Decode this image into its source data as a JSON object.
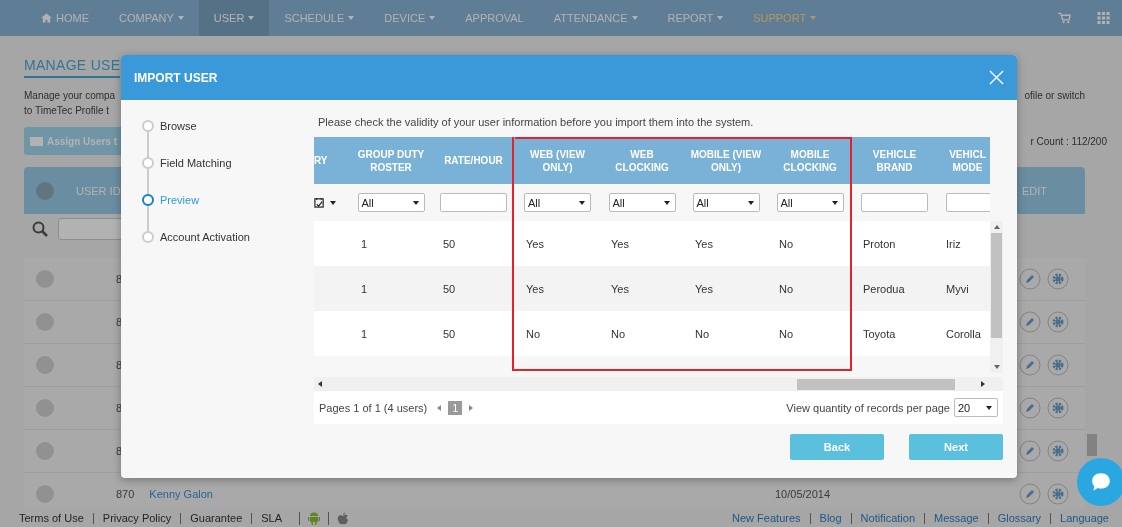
{
  "nav": {
    "items": [
      {
        "label": "HOME",
        "kind": "home",
        "selected": false,
        "accent": false
      },
      {
        "label": "COMPANY",
        "kind": "dropdown",
        "selected": false,
        "accent": false
      },
      {
        "label": "USER",
        "kind": "dropdown",
        "selected": true,
        "accent": false
      },
      {
        "label": "SCHEDULE",
        "kind": "dropdown",
        "selected": false,
        "accent": false
      },
      {
        "label": "DEVICE",
        "kind": "dropdown",
        "selected": false,
        "accent": false
      },
      {
        "label": "APPROVAL",
        "kind": "plain",
        "selected": false,
        "accent": false
      },
      {
        "label": "ATTENDANCE",
        "kind": "dropdown",
        "selected": false,
        "accent": false
      },
      {
        "label": "REPORT",
        "kind": "dropdown",
        "selected": false,
        "accent": false
      },
      {
        "label": "SUPPORT",
        "kind": "dropdown",
        "selected": false,
        "accent": true
      }
    ]
  },
  "page": {
    "title": "MANAGE USE",
    "description": [
      "Manage your compa",
      "to TimeTec Profile t"
    ],
    "description_right": "ofile or switch",
    "assign_button": "Assign Users t",
    "user_count": "r Count : 112/200",
    "table": {
      "columns": [
        "USER ID",
        "EDIT"
      ],
      "rows": [
        {
          "id": "8"
        },
        {
          "id": "8"
        },
        {
          "id": "8"
        },
        {
          "id": "8"
        },
        {
          "id": "8"
        },
        {
          "id": "870",
          "name": "Kenny Galon",
          "date": "10/05/2014"
        }
      ]
    }
  },
  "dialog": {
    "title": "IMPORT USER",
    "steps": [
      {
        "label": "Browse",
        "selected": false
      },
      {
        "label": "Field Matching",
        "selected": false
      },
      {
        "label": "Preview",
        "selected": true
      },
      {
        "label": "Account Activation",
        "selected": false
      }
    ],
    "intro": "Please check the validity of your user information before you import them into the system.",
    "columns": [
      {
        "label": "RY",
        "highlighted": false,
        "filter": {
          "kind": "date"
        }
      },
      {
        "label": "GROUP DUTY ROSTER",
        "highlighted": false,
        "filter": {
          "kind": "select",
          "value": "All"
        }
      },
      {
        "label": "RATE/HOUR",
        "highlighted": false,
        "filter": {
          "kind": "text"
        }
      },
      {
        "label": "WEB (VIEW ONLY)",
        "highlighted": true,
        "filter": {
          "kind": "select",
          "value": "All"
        }
      },
      {
        "label": "WEB CLOCKING",
        "highlighted": true,
        "filter": {
          "kind": "select",
          "value": "All"
        }
      },
      {
        "label": "MOBILE (VIEW ONLY)",
        "highlighted": true,
        "filter": {
          "kind": "select",
          "value": "All"
        }
      },
      {
        "label": "MOBILE CLOCKING",
        "highlighted": true,
        "filter": {
          "kind": "select",
          "value": "All"
        }
      },
      {
        "label": "VEHICLE BRAND",
        "highlighted": false,
        "filter": {
          "kind": "text"
        }
      },
      {
        "label": "VEHICL MODE",
        "highlighted": false,
        "filter": {
          "kind": "text"
        }
      }
    ],
    "rows": [
      [
        "",
        "1",
        "50",
        "Yes",
        "Yes",
        "Yes",
        "No",
        "Proton",
        "Iriz"
      ],
      [
        "",
        "1",
        "50",
        "Yes",
        "Yes",
        "Yes",
        "No",
        "Perodua",
        "Myvi"
      ],
      [
        "",
        "1",
        "50",
        "No",
        "No",
        "No",
        "No",
        "Toyota",
        "Corolla"
      ]
    ],
    "pager": {
      "summary": "Pages 1 of 1 (4 users)",
      "pages": [
        {
          "label": "1",
          "selected": true
        }
      ],
      "per_page_label": "View quantity of records per page",
      "per_page": "20"
    },
    "buttons": [
      "Back",
      "Next"
    ]
  },
  "footer": {
    "left": [
      "Terms of Use",
      "Privacy Policy",
      "Guarantee",
      "SLA"
    ],
    "right": [
      "New Features",
      "Blog",
      "Notification",
      "Message",
      "Glossary",
      "Language"
    ]
  }
}
